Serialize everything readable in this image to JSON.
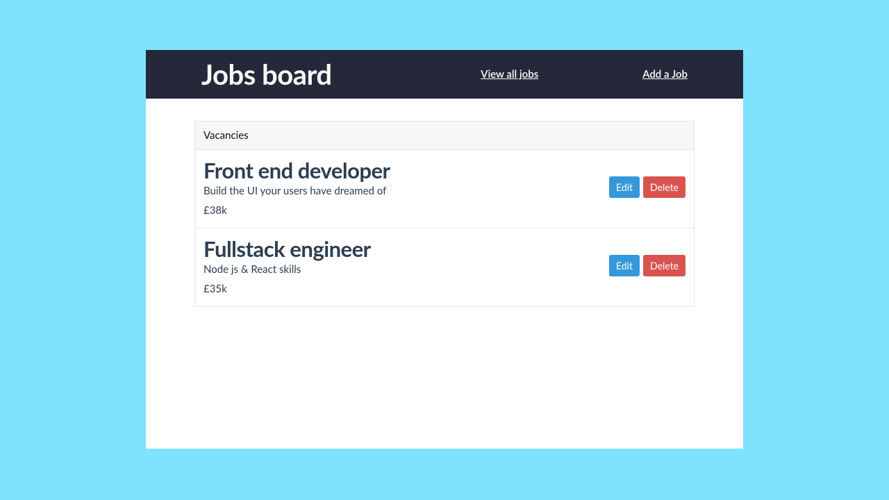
{
  "nav": {
    "brand": "Jobs board",
    "view_all": "View all jobs",
    "add_job": "Add a Job"
  },
  "panel": {
    "header": "Vacancies"
  },
  "jobs": [
    {
      "title": "Front end developer",
      "description": "Build the UI your users have dreamed of",
      "salary": "£38k",
      "edit": "Edit",
      "delete": "Delete"
    },
    {
      "title": "Fullstack engineer",
      "description": "Node js & React skills",
      "salary": "£35k",
      "edit": "Edit",
      "delete": "Delete"
    }
  ]
}
